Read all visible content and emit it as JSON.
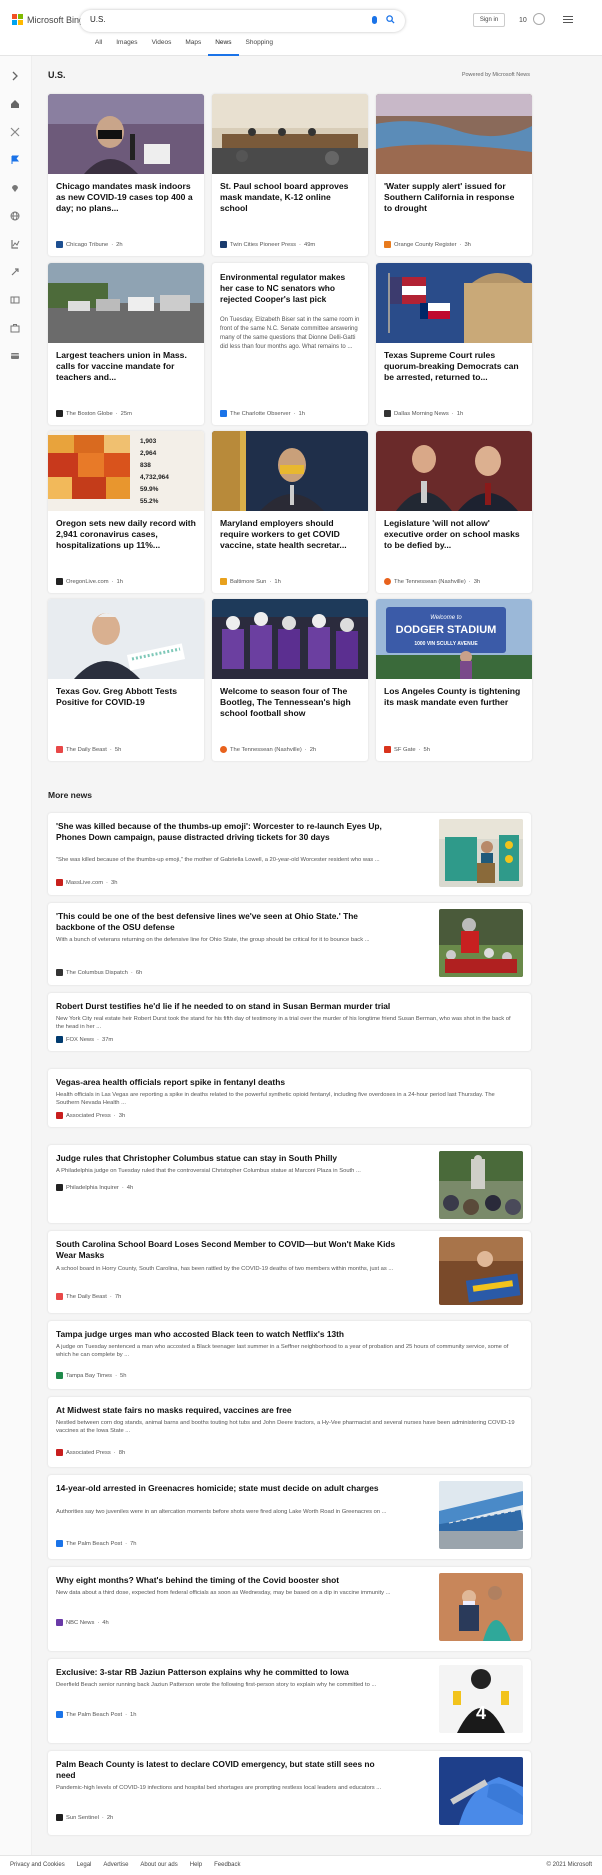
{
  "header": {
    "brand": "Microsoft Bing",
    "search_value": "U.S.",
    "signin": "Sign in",
    "rewards": "10",
    "tabs": [
      "All",
      "Images",
      "Videos",
      "Maps",
      "News",
      "Shopping"
    ],
    "active_tab": "News"
  },
  "sidebar": {
    "icons": [
      "chevron-right-icon",
      "home-icon",
      "tools-icon",
      "flag-icon",
      "location-icon",
      "globe-icon",
      "scales-icon",
      "rocket-icon",
      "film-icon",
      "briefcase-icon",
      "card-icon"
    ]
  },
  "section": {
    "title": "U.S.",
    "powered": "Powered by Microsoft News"
  },
  "cards": [
    {
      "title": "Chicago mandates mask indoors as new COVID-19 cases top 400 a day; no plans...",
      "source": "Chicago Tribune",
      "time": "2h"
    },
    {
      "title": "St. Paul school board approves mask mandate, K-12 online school",
      "source": "Twin Cities Pioneer Press",
      "time": "49m"
    },
    {
      "title": "'Water supply alert' issued for Southern California in response to drought",
      "source": "Orange County Register",
      "time": "3h"
    },
    {
      "title": "Largest teachers union in Mass. calls for vaccine mandate for teachers and...",
      "source": "The Boston Globe",
      "time": "25m"
    },
    {
      "title": "Environmental regulator makes her case to NC senators who rejected Cooper's last pick",
      "desc": "On Tuesday, Elizabeth Biser sat in the same room in front of the same N.C. Senate committee answering many of the same questions that Dionne Delli-Gatti did less than four months ago. What remains to ...",
      "source": "The Charlotte Observer",
      "time": "1h"
    },
    {
      "title": "Texas Supreme Court rules quorum-breaking Democrats can be arrested, returned to...",
      "source": "Dallas Morning News",
      "time": "1h"
    },
    {
      "title": "Oregon sets new daily record with 2,941 coronavirus cases, hospitalizations up 11%...",
      "source": "OregonLive.com",
      "time": "1h"
    },
    {
      "title": "Maryland employers should require workers to get COVID vaccine, state health secretar...",
      "source": "Baltimore Sun",
      "time": "1h"
    },
    {
      "title": "Legislature 'will not allow' executive order on school masks to be defied by...",
      "source": "The Tennessean (Nashville)",
      "time": "3h"
    },
    {
      "title": "Texas Gov. Greg Abbott Tests Positive for COVID-19",
      "source": "The Daily Beast",
      "time": "5h"
    },
    {
      "title": "Welcome to season four of The Bootleg, The Tennessean's high school football show",
      "source": "The Tennessean (Nashville)",
      "time": "2h"
    },
    {
      "title": "Los Angeles County is tightening its mask mandate even further",
      "source": "SF Gate",
      "time": "5h"
    }
  ],
  "oregon_chart_labels": [
    "1,903",
    "2,964",
    "838",
    "4,732,964",
    "59.9%",
    "55.2%"
  ],
  "dodger_sign": {
    "small": "Welcome to",
    "big": "DODGER STADIUM",
    "street": "1000 VIN SCULLY AVENUE"
  },
  "more_news_title": "More news",
  "more_news": [
    {
      "title": "'She was killed because of the thumbs-up emoji': Worcester to re-launch Eyes Up, Phones Down campaign, pause distracted driving tickets for 30 days",
      "desc": "\"She was killed because of the thumbs-up emoji,\" the mother of Gabriella Lowell, a 20-year-old Worcester resident who was ...",
      "source": "MassLive.com",
      "time": "3h"
    },
    {
      "title": "'This could be one of the best defensive lines we've seen at Ohio State.' The backbone of the OSU defense",
      "desc": "With a bunch of veterans returning on the defensive line for Ohio State, the group should be critical for it to bounce back ...",
      "source": "The Columbus Dispatch",
      "time": "6h"
    },
    {
      "title": "Robert Durst testifies he'd lie if he needed to on stand in Susan Berman murder trial",
      "desc": "New York City real estate heir Robert Durst took the stand for his fifth day of testimony in a trial over the murder of his longtime friend Susan Berman, who was shot in the back of the head in her ...",
      "source": "FOX News",
      "time": "37m"
    },
    {
      "title": "Vegas-area health officials report spike in fentanyl deaths",
      "desc": "Health officials in Las Vegas are reporting a spike in deaths related to the powerful synthetic opioid fentanyl, including five overdoses in a 24-hour period last Thursday. The Southern Nevada Health ...",
      "source": "Associated Press",
      "time": "3h"
    },
    {
      "title": "Judge rules that Christopher Columbus statue can stay in South Philly",
      "desc": "A Philadelphia judge on Tuesday ruled that the controversial Christopher Columbus statue at Marconi Plaza in South ...",
      "source": "Philadelphia Inquirer",
      "time": "4h"
    },
    {
      "title": "South Carolina School Board Loses Second Member to COVID—but Won't Make Kids Wear Masks",
      "desc": "A school board in Horry County, South Carolina, has been rattled by the COVID-19 deaths of two members within months, just as ...",
      "source": "The Daily Beast",
      "time": "7h"
    },
    {
      "title": "Tampa judge urges man who accosted Black teen to watch Netflix's 13th",
      "desc": "A judge on Tuesday sentenced a man who accosted a Black teenager last summer in a Seffner neighborhood to a year of probation and 25 hours of community service, some of which he can complete by ...",
      "source": "Tampa Bay Times",
      "time": "5h"
    },
    {
      "title": "At Midwest state fairs no masks required, vaccines are free",
      "desc": "Nestled between corn dog stands, animal barns and booths touting hot tubs and John Deere tractors, a Hy-Vee pharmacist and several nurses have been administering COVID-19 vaccines at the Iowa State ...",
      "source": "Associated Press",
      "time": "8h"
    },
    {
      "title": "14-year-old arrested in Greenacres homicide; state must decide on adult charges",
      "desc": "Authorities say two juveniles were in an altercation moments before shots were fired along Lake Worth Road in Greenacres on ...",
      "source": "The Palm Beach Post",
      "time": "7h"
    },
    {
      "title": "Why eight months? What's behind the timing of the Covid booster shot",
      "desc": "New data about a third dose, expected from federal officials as soon as Wednesday, may be based on a dip in vaccine immunity ...",
      "source": "NBC News",
      "time": "4h"
    },
    {
      "title": "Exclusive: 3-star RB Jaziun Patterson explains why he committed to Iowa",
      "desc": "Deerfield Beach senior running back Jaziun Patterson wrote the following first-person story to explain why he committed to ...",
      "source": "The Palm Beach Post",
      "time": "1h"
    },
    {
      "title": "Palm Beach County is latest to declare COVID emergency, but state still sees no need",
      "desc": "Pandemic-high levels of COVID-19 infections and hospital bed shortages are prompting restless local leaders and educators ...",
      "source": "Sun Sentinel",
      "time": "2h"
    }
  ],
  "jersey_number": "4",
  "footer": {
    "links": [
      "Privacy and Cookies",
      "Legal",
      "Advertise",
      "About our ads",
      "Help",
      "Feedback"
    ],
    "copyright": "© 2021 Microsoft"
  },
  "colors": {
    "accent": "#1a73e8",
    "ms_red": "#f25022",
    "ms_green": "#7fba00",
    "ms_blue": "#00a4ef",
    "ms_yellow": "#ffb900"
  }
}
